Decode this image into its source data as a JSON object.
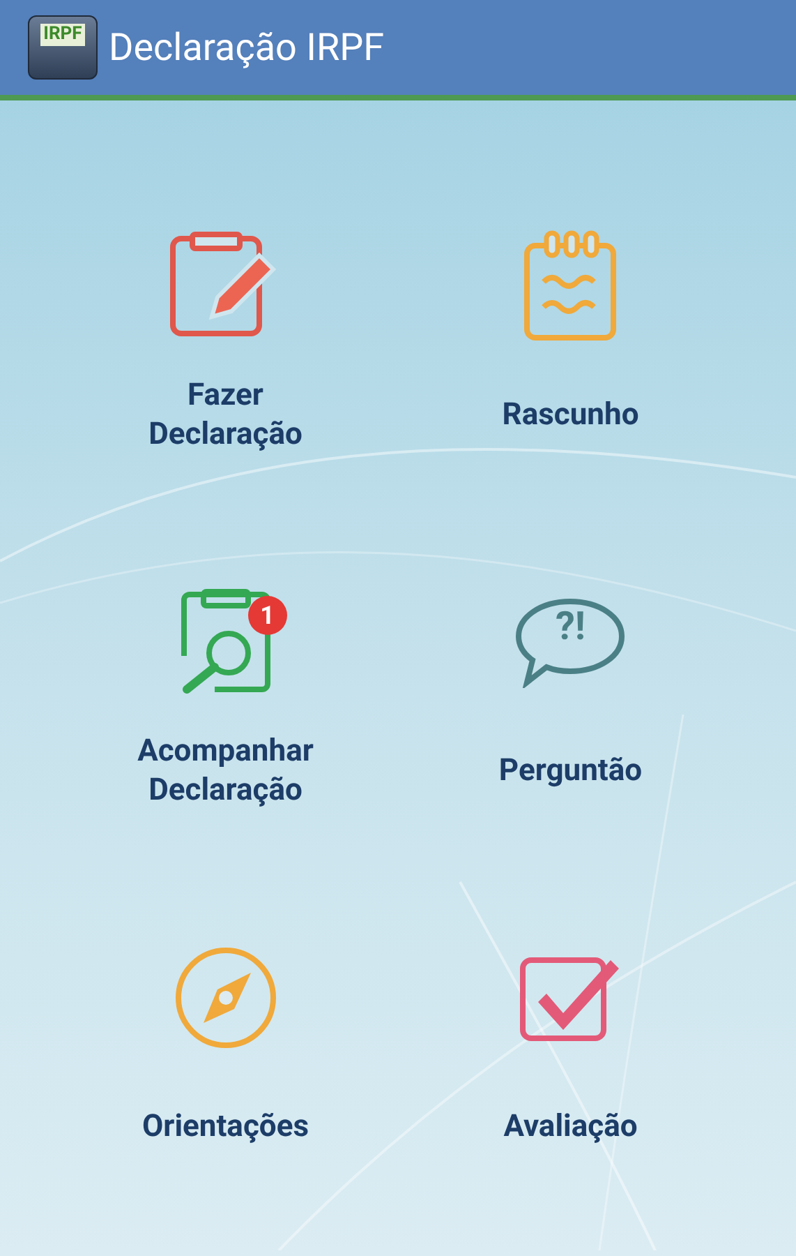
{
  "app_bar": {
    "logo_text": "IRPF",
    "title": "Declaração IRPF"
  },
  "tiles": [
    {
      "label": "Fazer Declaração"
    },
    {
      "label": "Rascunho"
    },
    {
      "label": "Acompanhar Declaração",
      "badge": "1"
    },
    {
      "label": "Perguntão",
      "icon_text": "?!"
    },
    {
      "label": "Orientações"
    },
    {
      "label": "Avaliação"
    }
  ]
}
